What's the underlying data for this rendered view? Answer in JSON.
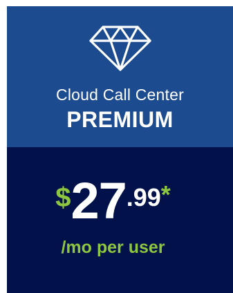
{
  "plan_card": {
    "icon": "diamond-icon",
    "product_name": "Cloud Call Center",
    "plan_name": "PREMIUM",
    "price": {
      "currency_symbol": "$",
      "dollars": "27",
      "cents": ".99",
      "footnote_mark": "*"
    },
    "billing_period": "/mo per user"
  },
  "colors": {
    "header_background": "#1d4b8f",
    "price_background": "#021149",
    "accent_green": "#8dc63f",
    "text_white": "#ffffff"
  }
}
